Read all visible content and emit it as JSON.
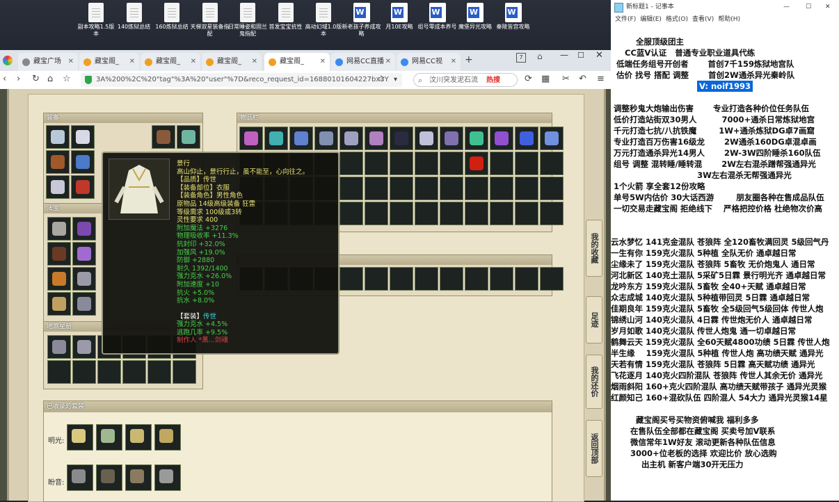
{
  "desktop": {
    "icons": [
      {
        "label": "副本攻略1.5版本",
        "type": "doc"
      },
      {
        "label": "140炼狱总结",
        "type": "doc"
      },
      {
        "label": "160炼狱总结",
        "type": "doc"
      },
      {
        "label": "天梯双星装备指配",
        "type": "doc"
      },
      {
        "label": "日常睡姿和固兰鬼指配",
        "type": "doc"
      },
      {
        "label": "首发宝宝抗性",
        "type": "doc"
      },
      {
        "label": "高动幻域1.0版本",
        "type": "doc"
      },
      {
        "label": "新老孩子养成攻略",
        "type": "word"
      },
      {
        "label": "月10E攻略",
        "type": "word"
      },
      {
        "label": "组号零成本养号",
        "type": "word"
      },
      {
        "label": "魔堡异光攻略",
        "type": "word"
      },
      {
        "label": "秦陵皆宫攻略",
        "type": "word"
      }
    ]
  },
  "browser": {
    "tabs": [
      "藏宝广场",
      "藏宝阁_",
      "藏宝阁_",
      "藏宝阁_",
      "藏宝阁_",
      "网易CC直播",
      "网易CC视"
    ],
    "url": "3A%200%2C%20\"tag\"%3A%20\"user\"%7D&reco_request_id=16880101604227bx3Y",
    "search_text": "汶川突发泥石流",
    "hot_label": "热搜",
    "tab_count": "7"
  },
  "game": {
    "equip_title": "装备",
    "bag_title": "物品栏",
    "fabao_title": "法宝",
    "jiyuan_title": "地煞星册",
    "side_buttons": [
      "我的收藏",
      "足迹",
      "我的还价",
      "返回顶部"
    ],
    "suits_title": "已收录的套装",
    "suit_rows": [
      "明光:",
      "盼音:"
    ]
  },
  "tooltip": {
    "name": "景行",
    "desc": "高山仰止，景行行止，虽不能至，心向往之。",
    "lines_yellow": [
      "【品质】传世",
      "【装备部位】衣服",
      "【装备角色】男性角色",
      "原物品 14级高级装备 狂雷",
      "等级需求 100级或3转",
      "灵性要求 400"
    ],
    "lines_green": [
      "附加魔法 +3276",
      "物理吸收率 +11.3%",
      "抗封印 +32.0%",
      "加强风 +19.0%",
      "防御 +2880",
      "耐久 1392/1400",
      "强力克水 +26.0%",
      "附加速度 +10",
      "抗火 +5.0%",
      "抗水 +8.0%"
    ],
    "suit_label": "【套装】",
    "suit_value": "传世",
    "suit_lines": [
      "强力克水 +4.5%",
      "逃跑几率 +9.5%"
    ],
    "maker": "制作人 *黑...剑魂"
  },
  "notepad": {
    "title": "新标题1 - 记事本",
    "menu": [
      "文件(F)",
      "编辑(E)",
      "格式(O)",
      "查看(V)",
      "帮助(H)"
    ],
    "lines": [
      "",
      "         全服顶级团主",
      "     CC蓝V认证   普通专业职业道具代练",
      "  低端任务组号开创者       首创7千159炼狱地宫队",
      "  估价 找号 搭配 调整       首创2W通杀异光秦岭队",
      "",
      "",
      " 调整秒鬼大炮输出伤害       专业打造各种价位任务队伍",
      " 低价打造站街双30男人         7000+通杀日常炼狱地宫",
      " 千元打造七抗/八抗铁魔        1W+通杀炼狱DG卓7画窟",
      " 专业打造百万伤害16级龙       2W通杀160DG卓混卓画",
      " 万元打造通杀异光14男人       2W-3W四阶睡杀160队伍",
      " 组号 调整 混转睡/睡转混       2W左右混杀蹭帮强通异光",
      "                               3W左右混杀无帮强通异光",
      " 1个火箭 享全套12份攻略",
      " 单号5W内估价 30大话西游        朋友圈各种在售成品队伍",
      " 一切交易走藏宝阁 拒绝线下    严格把控价格 杜绝物次价高",
      "",
      "",
      "云水梦忆 141克金混队 苍狼阵 全120畜牧满回灵 5级回气丹",
      "一生有你 159克火混队 5种植 全队无价 通卓越日常",
      "尘缘未了 159克火混队 苍狼阵 5畜牧 无价炮鬼人 通日常",
      "河北新区 140克土混队 5采矿5日霖 景行明光齐 通卓越日常",
      "龙吟东方 159克火混队 5畜牧 全40+天赋 通卓越日常",
      "众志成城 140克火混队 5种植带回灵 5日霖 通卓越日常",
      "佳期良年 159克火混队 5畜牧 全5级回气5级回体 传世人炮",
      "锦绣山河 140克火混队 4日霖 传世炮无价人 通卓越日常",
      "岁月如歌 140克火混队 传世人炮鬼 通一切卓越日常",
      "鹤舞云天 159克火混队 全60天赋4800功绩 5日霖 传世人炮",
      "半生缘    159克火混队 5种植 传世人炮 高功绩天赋 通异光",
      "天若有情 159克火混队 苍狼阵 5日霖 高天赋功绩 通异光",
      "飞花逐月 140克火四阶混队 苍狼阵 传世人其余无价 通异光",
      "烟雨斜阳 160+克火四阶混队 高功绩天赋带孩子 通异光灵猴",
      "红颜知己 160+混砍队伍 四阶混人 54大力 通异光灵猴14星",
      "",
      "         藏宝阁买号买物资俯喊我 福利多多",
      "       在售队伍全部都在藏宝阁 买卖号加V联系",
      "       微信常年1W好友 滚动更新各种队伍信息",
      "       3000+位老板的选择 欢迎比价 放心选购",
      "           出主机 新客户端30开无压力"
    ],
    "highlight": "V: noif1993"
  }
}
